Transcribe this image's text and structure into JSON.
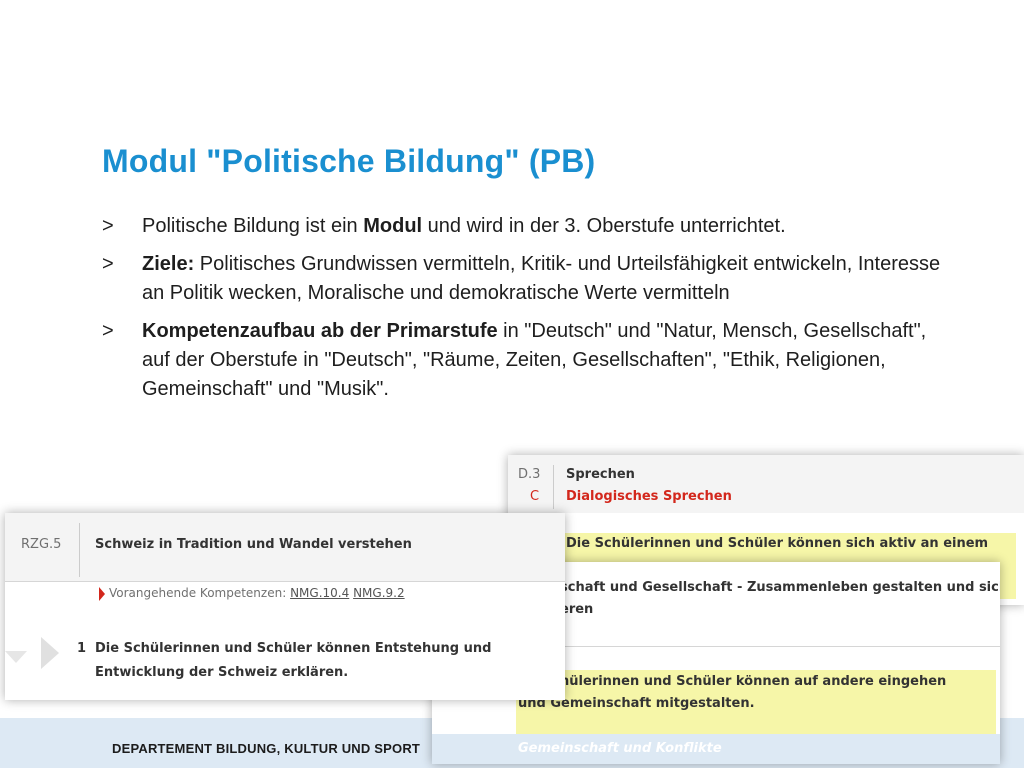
{
  "slide": {
    "title": "Modul \"Politische Bildung\" (PB)",
    "bullet_marker": ">",
    "bullets": [
      {
        "pre": "Politische Bildung ist ein ",
        "bold": "Modul",
        "post": " und wird in der 3. Oberstufe unterrichtet."
      },
      {
        "pre": "",
        "bold": "Ziele:",
        "post": " Politisches Grundwissen vermitteln, Kritik- und Urteilsfähigkeit entwickeln, Interesse an Politik wecken, Moralische und demokratische Werte vermitteln"
      },
      {
        "pre": "",
        "bold": "Kompetenzaufbau ab der Primarstufe",
        "post": " in \"Deutsch\" und \"Natur, Mensch, Gesellschaft\", auf der Oberstufe in \"Deutsch\", \"Räume, Zeiten, Gesellschaften\", \"Ethik, Religionen, Gemeinschaft\" und \"Musik\"."
      }
    ],
    "footer": "DEPARTEMENT BILDUNG, KULTUR UND SPORT"
  },
  "card_deutsch": {
    "code": "D.3",
    "sub_code": "C",
    "heading": "Sprechen",
    "subheading": "Dialogisches Sprechen",
    "competence_partial": "Die Schülerinnen und Schüler können sich aktiv an einem"
  },
  "card_erg": {
    "heading_partial": "schaft und Gesellschaft - Zusammenleben gestalten und sich",
    "heading_line2_partial": "eren",
    "competence_line1_partial": "hülerinnen und Schüler können auf andere eingehen",
    "competence_line2_partial": "und Gemeinschaft mitgestalten.",
    "footer_partial": "Gemeinschaft und Konflikte"
  },
  "card_rzg": {
    "code": "RZG.5",
    "heading": "Schweiz in Tradition und Wandel verstehen",
    "prev_label": "Vorangehende Kompetenzen:",
    "prev_links": [
      "NMG.10.4",
      "NMG.9.2"
    ],
    "competence_number": "1",
    "competence_line1": "Die Schülerinnen und Schüler können Entstehung und",
    "competence_line2": "Entwicklung der Schweiz erklären."
  },
  "colors": {
    "title": "#1a8fd0",
    "lp_red": "#d3271c",
    "highlight": "#f6f6a8",
    "footer_band": "#dde9f4"
  }
}
